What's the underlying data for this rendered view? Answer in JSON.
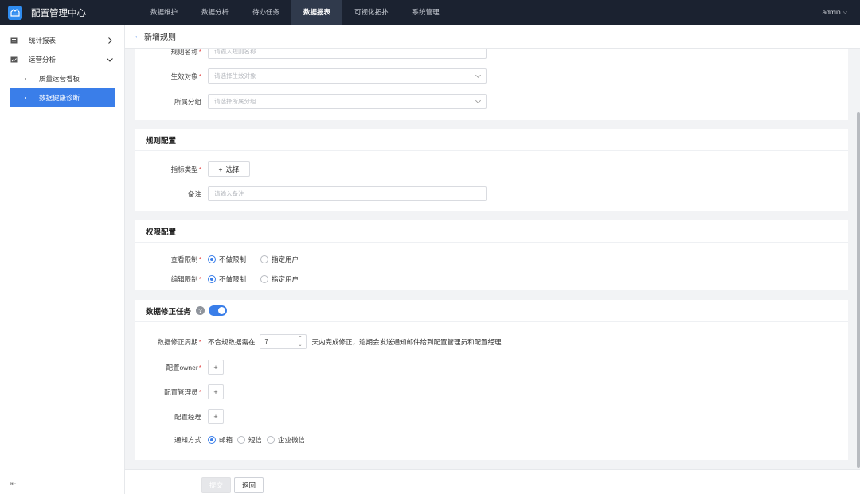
{
  "app": {
    "title": "配置管理中心",
    "user": "admin"
  },
  "nav": [
    {
      "label": "数据维护"
    },
    {
      "label": "数据分析"
    },
    {
      "label": "待办任务"
    },
    {
      "label": "数据报表"
    },
    {
      "label": "可视化拓扑"
    },
    {
      "label": "系统管理"
    }
  ],
  "nav_active": "数据报表",
  "sidebar": {
    "groups": [
      {
        "label": "统计报表",
        "icon": "report-icon",
        "expanded": false
      },
      {
        "label": "运营分析",
        "icon": "chart-icon",
        "expanded": true
      }
    ],
    "items": [
      {
        "label": "质量运营看板"
      },
      {
        "label": "数据健康诊断"
      }
    ],
    "active_item": "数据健康诊断",
    "collapse_icon": "collapse-sidebar-icon"
  },
  "page": {
    "back_icon": "arrow-left-icon",
    "title": "新增规则"
  },
  "basic": {
    "rule_name": {
      "label": "规则名称",
      "placeholder": "请输入规则名称"
    },
    "target": {
      "label": "生效对象",
      "placeholder": "请选择生效对象"
    },
    "group": {
      "label": "所属分组",
      "placeholder": "请选择所属分组"
    }
  },
  "rule_config": {
    "title": "规则配置",
    "metric_type": {
      "label": "指标类型",
      "button": "选择"
    },
    "remark": {
      "label": "备注",
      "placeholder": "请输入备注"
    }
  },
  "permission": {
    "title": "权限配置",
    "view": {
      "label": "查看限制",
      "options": [
        "不做限制",
        "指定用户"
      ],
      "selected": "不做限制"
    },
    "edit": {
      "label": "编辑限制",
      "options": [
        "不做限制",
        "指定用户"
      ],
      "selected": "不做限制"
    }
  },
  "fix_task": {
    "title": "数据修正任务",
    "enabled": true,
    "period": {
      "label": "数据修正周期",
      "prefix": "不合规数据需在",
      "value": "7",
      "suffix": "天内完成修正，逾期会发送通知邮件给到配置管理员和配置经理"
    },
    "owner": {
      "label": "配置owner"
    },
    "admin": {
      "label": "配置管理员"
    },
    "manager": {
      "label": "配置经理"
    },
    "notify": {
      "label": "通知方式",
      "options": [
        "邮箱",
        "短信",
        "企业微信"
      ],
      "selected": "邮箱"
    }
  },
  "footer": {
    "submit": "提交",
    "back": "返回"
  },
  "colors": {
    "accent": "#3a7ee9",
    "topbar": "#1b2230",
    "required": "#e34d4d"
  }
}
